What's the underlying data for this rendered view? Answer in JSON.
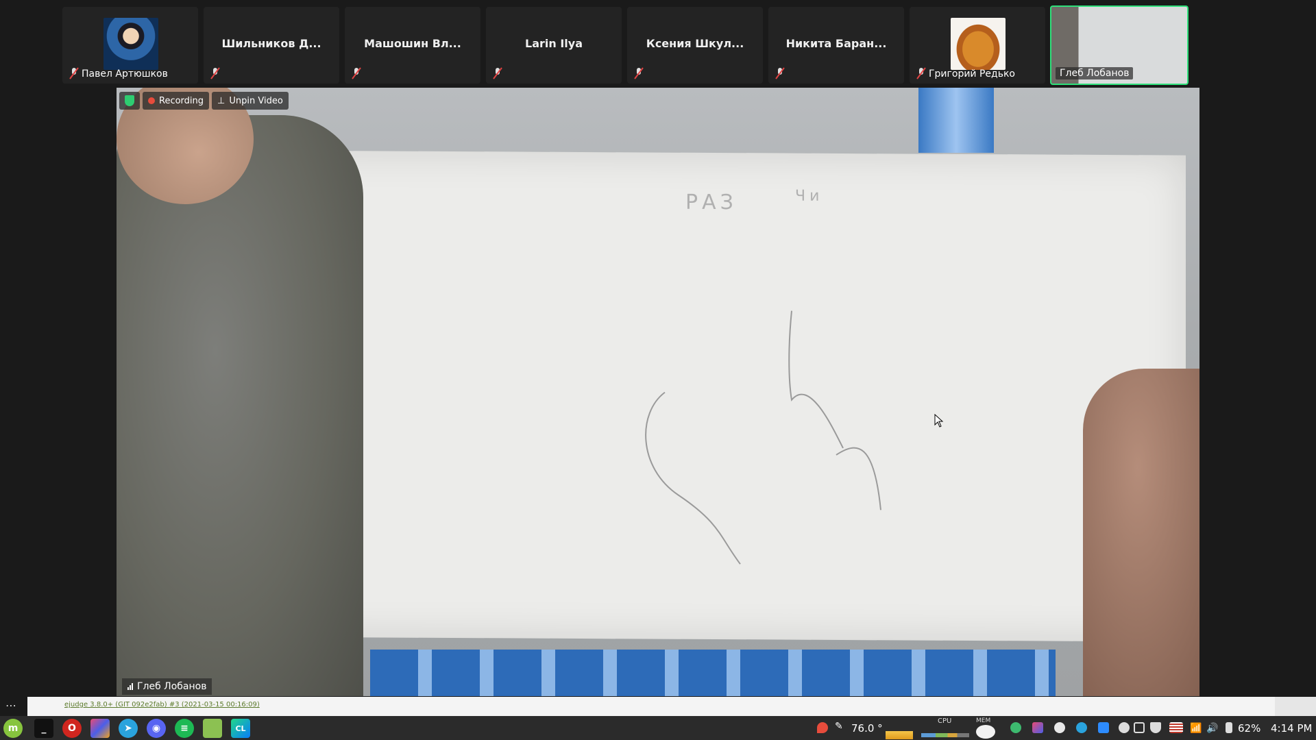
{
  "participants": [
    {
      "name": "Павел Артюшков",
      "muted": true,
      "has_photo": true
    },
    {
      "name": "Шильников Д...",
      "muted": true
    },
    {
      "name": "Машошин Вл...",
      "muted": true
    },
    {
      "name": "Larin Ilya",
      "muted": true
    },
    {
      "name": "Ксения Шкул...",
      "muted": true
    },
    {
      "name": "Никита Баран...",
      "muted": true
    },
    {
      "name": "Григорий Редько",
      "muted": true,
      "has_photo": true
    },
    {
      "name": "Глеб Лобанов",
      "active_speaker": true
    }
  ],
  "video": {
    "recording_label": "Recording",
    "unpin_label": "Unpin Video",
    "speaker_name": "Глеб Лобанов",
    "whiteboard_text_1": "РАЗ",
    "whiteboard_text_2": "Чи"
  },
  "browser": {
    "status_link": "ejudge 3.8.0+ (GIT 092e2fab) #3 (2021-03-15 00:16:09)"
  },
  "taskbar": {
    "apps": [
      "mint-menu-icon",
      "terminal-icon",
      "opera-icon",
      "jetbrains-toolbox-icon",
      "telegram-icon",
      "discord-icon",
      "spotify-icon",
      "files-icon",
      "clion-icon"
    ],
    "temperature": "76.0 °",
    "cpu_label": "CPU",
    "mem_label": "MEM",
    "battery": "62%",
    "time": "4:14 PM"
  },
  "colors": {
    "active_border": "#2ee07a",
    "recording_dot": "#e74c3c",
    "security_shield": "#2ecc71"
  }
}
